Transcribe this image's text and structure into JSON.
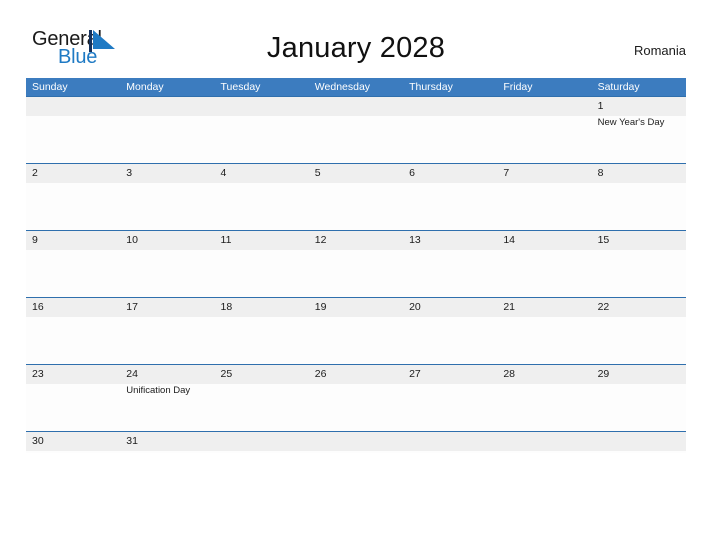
{
  "brand": {
    "name_part1": "General",
    "name_part2": "Blue",
    "triangle_color": "#1f7ac4",
    "triangle_edge_color": "#14315c"
  },
  "header": {
    "title": "January 2028",
    "country": "Romania",
    "accent_color": "#3c7cbf"
  },
  "calendar": {
    "weekday_headers": [
      "Sunday",
      "Monday",
      "Tuesday",
      "Wednesday",
      "Thursday",
      "Friday",
      "Saturday"
    ],
    "weeks": [
      [
        {
          "date": "",
          "event": ""
        },
        {
          "date": "",
          "event": ""
        },
        {
          "date": "",
          "event": ""
        },
        {
          "date": "",
          "event": ""
        },
        {
          "date": "",
          "event": ""
        },
        {
          "date": "",
          "event": ""
        },
        {
          "date": "1",
          "event": "New Year's Day"
        }
      ],
      [
        {
          "date": "2",
          "event": ""
        },
        {
          "date": "3",
          "event": ""
        },
        {
          "date": "4",
          "event": ""
        },
        {
          "date": "5",
          "event": ""
        },
        {
          "date": "6",
          "event": ""
        },
        {
          "date": "7",
          "event": ""
        },
        {
          "date": "8",
          "event": ""
        }
      ],
      [
        {
          "date": "9",
          "event": ""
        },
        {
          "date": "10",
          "event": ""
        },
        {
          "date": "11",
          "event": ""
        },
        {
          "date": "12",
          "event": ""
        },
        {
          "date": "13",
          "event": ""
        },
        {
          "date": "14",
          "event": ""
        },
        {
          "date": "15",
          "event": ""
        }
      ],
      [
        {
          "date": "16",
          "event": ""
        },
        {
          "date": "17",
          "event": ""
        },
        {
          "date": "18",
          "event": ""
        },
        {
          "date": "19",
          "event": ""
        },
        {
          "date": "20",
          "event": ""
        },
        {
          "date": "21",
          "event": ""
        },
        {
          "date": "22",
          "event": ""
        }
      ],
      [
        {
          "date": "23",
          "event": ""
        },
        {
          "date": "24",
          "event": "Unification Day"
        },
        {
          "date": "25",
          "event": ""
        },
        {
          "date": "26",
          "event": ""
        },
        {
          "date": "27",
          "event": ""
        },
        {
          "date": "28",
          "event": ""
        },
        {
          "date": "29",
          "event": ""
        }
      ],
      [
        {
          "date": "30",
          "event": ""
        },
        {
          "date": "31",
          "event": ""
        },
        {
          "date": "",
          "event": ""
        },
        {
          "date": "",
          "event": ""
        },
        {
          "date": "",
          "event": ""
        },
        {
          "date": "",
          "event": ""
        },
        {
          "date": "",
          "event": ""
        }
      ]
    ]
  }
}
